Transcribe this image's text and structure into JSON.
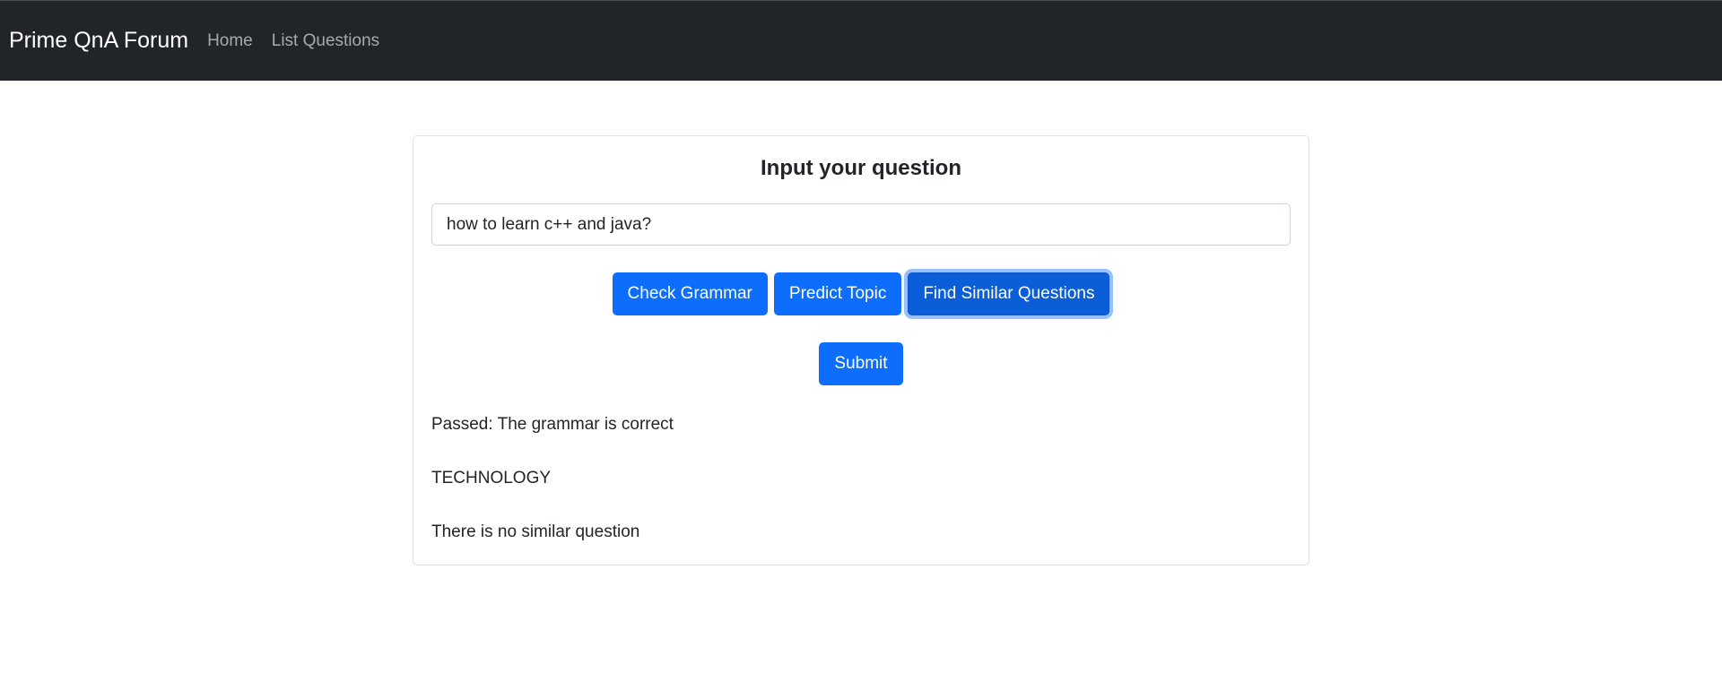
{
  "navbar": {
    "brand": "Prime QnA Forum",
    "links": [
      {
        "label": "Home"
      },
      {
        "label": "List Questions"
      }
    ]
  },
  "form": {
    "title": "Input your question",
    "input_value": "how to learn c++ and java?",
    "buttons": {
      "check_grammar": "Check Grammar",
      "predict_topic": "Predict Topic",
      "find_similar": "Find Similar Questions"
    },
    "submit_label": "Submit"
  },
  "results": {
    "grammar": "Passed: The grammar is correct",
    "topic": "TECHNOLOGY",
    "similar": "There is no similar question"
  },
  "colors": {
    "navbar_bg": "#212529",
    "primary": "#0d6efd"
  }
}
